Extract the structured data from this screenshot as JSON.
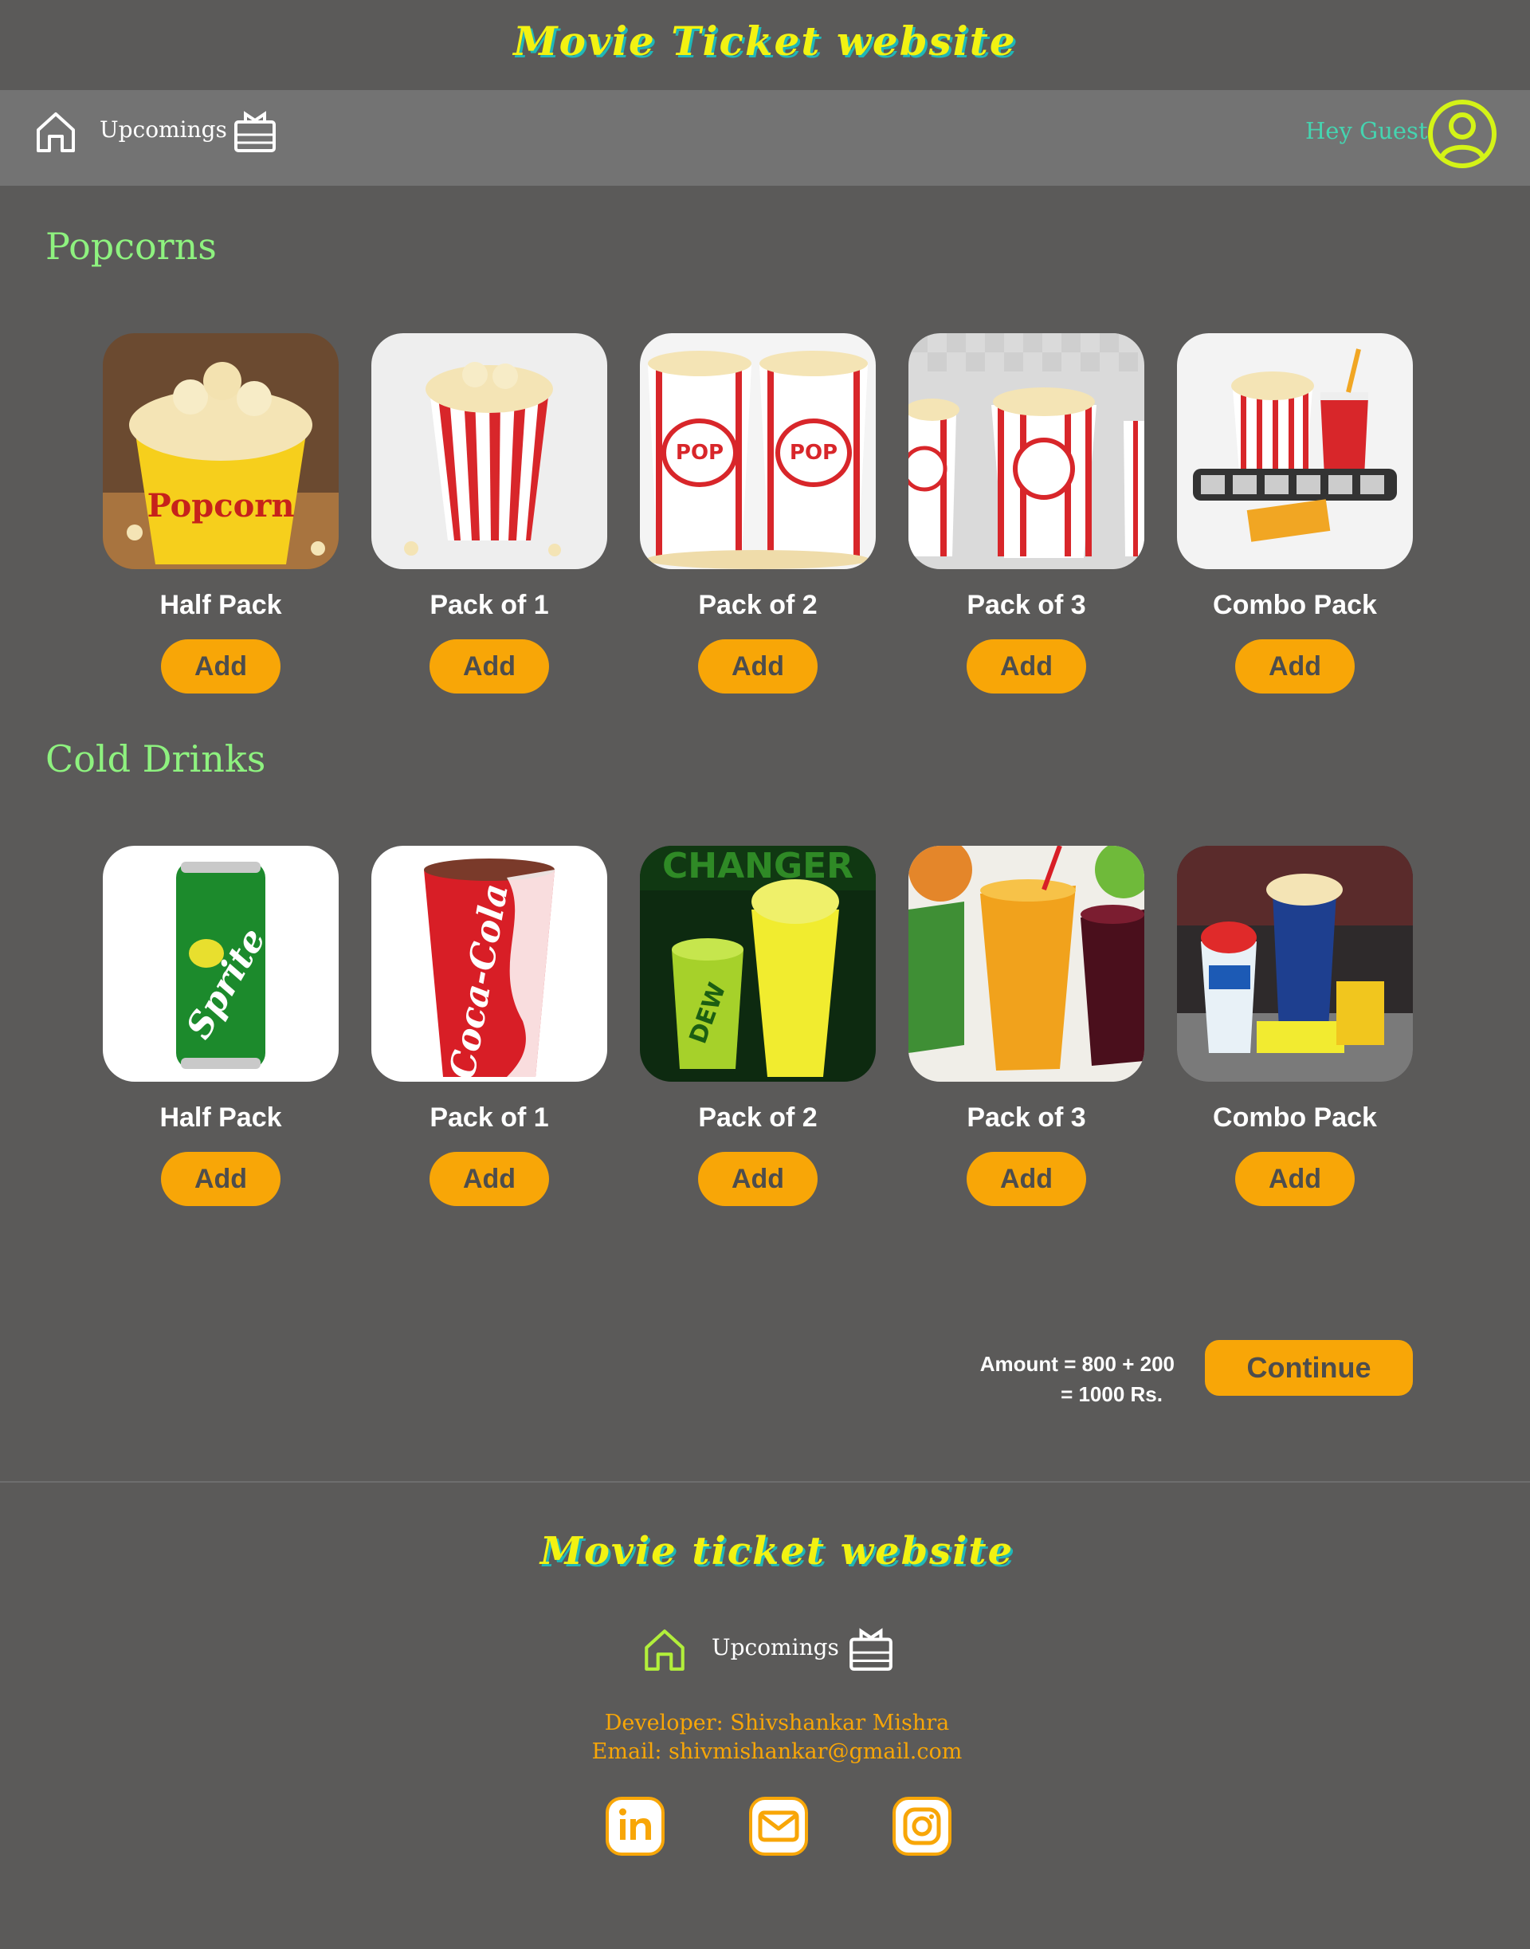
{
  "header": {
    "title": "Movie Ticket website"
  },
  "nav": {
    "home_icon": "home-icon",
    "upcoming_label": "Upcomings",
    "ticket_icon": "ticket-icon",
    "greeting": "Hey Guest",
    "user_icon": "user-circle-icon"
  },
  "sections": [
    {
      "title": "Popcorns",
      "items": [
        {
          "label": "Half Pack",
          "button": "Add",
          "image": "popcorn-bucket-image"
        },
        {
          "label": "Pack of 1",
          "button": "Add",
          "image": "popcorn-box-image"
        },
        {
          "label": "Pack of 2",
          "button": "Add",
          "image": "popcorn-two-boxes-image"
        },
        {
          "label": "Pack of 3",
          "button": "Add",
          "image": "popcorn-three-boxes-image"
        },
        {
          "label": "Combo Pack",
          "button": "Add",
          "image": "popcorn-combo-image"
        }
      ]
    },
    {
      "title": "Cold Drinks",
      "items": [
        {
          "label": "Half Pack",
          "button": "Add",
          "image": "sprite-can-image"
        },
        {
          "label": "Pack of 1",
          "button": "Add",
          "image": "coca-cola-cup-image"
        },
        {
          "label": "Pack of 2",
          "button": "Add",
          "image": "mountain-dew-image"
        },
        {
          "label": "Pack of 3",
          "button": "Add",
          "image": "juice-glasses-image"
        },
        {
          "label": "Combo Pack",
          "button": "Add",
          "image": "snack-combo-image"
        }
      ]
    }
  ],
  "cart": {
    "amount_line1": "Amount = 800 + 200",
    "amount_line2": "= 1000 Rs.",
    "continue_label": "Continue"
  },
  "footer": {
    "title": "Movie ticket website",
    "upcoming_label": "Upcomings",
    "developer": "Developer: Shivshankar Mishra",
    "email": "Email: shivmishankar@gmail.com",
    "social_icons": [
      "linkedin-icon",
      "mail-icon",
      "instagram-icon"
    ]
  },
  "colors": {
    "background": "#5b5a59",
    "navbar": "#737373",
    "accent": "#f8a607",
    "title_yellow": "#f2f212",
    "section_green": "#8ef27f",
    "greeting_teal": "#45d4b0"
  }
}
